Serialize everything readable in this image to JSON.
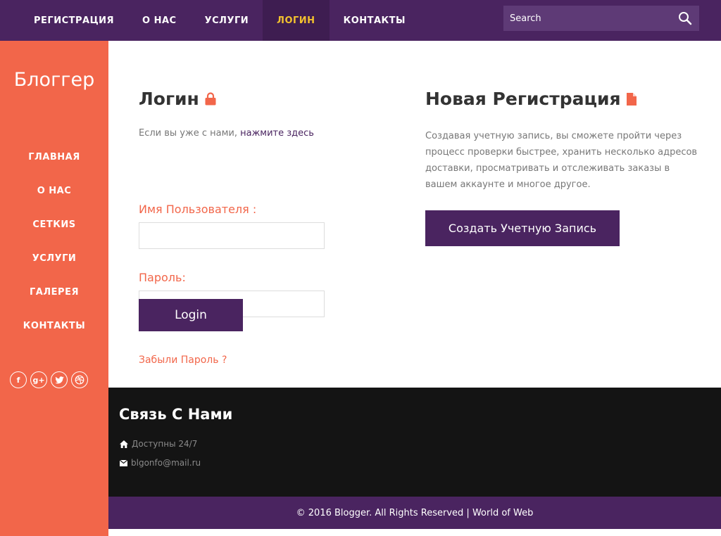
{
  "colors": {
    "nav_bg": "#4a2460",
    "nav_active_bg": "#3e1d51",
    "nav_active_text": "#f2c12e",
    "sidebar_bg": "#f2664a",
    "accent": "#f2664a",
    "button_bg": "#4a2460",
    "footer_bg": "#141414"
  },
  "topnav": {
    "items": [
      {
        "label": "РЕГИСТРАЦИЯ"
      },
      {
        "label": "О НАС"
      },
      {
        "label": "УСЛУГИ"
      },
      {
        "label": "ЛОГИН",
        "active": true
      },
      {
        "label": "КОНТАКТЫ"
      }
    ],
    "search": {
      "placeholder": "Search",
      "icon": "search-icon"
    }
  },
  "sidebar": {
    "brand": "Блоггер",
    "items": [
      {
        "label": "ГЛАВНАЯ"
      },
      {
        "label": "О НАС"
      },
      {
        "label": "СЕТКИS"
      },
      {
        "label": "УСЛУГИ"
      },
      {
        "label": "ГАЛЕРЕЯ"
      },
      {
        "label": "КОНТАКТЫ"
      }
    ],
    "socials": [
      "facebook-icon",
      "google-plus-icon",
      "twitter-icon",
      "dribbble-icon"
    ]
  },
  "login": {
    "title": "Логин",
    "icon": "lock-icon",
    "hint_text": "Если вы уже с нами,",
    "hint_link": "нажмите здесь",
    "username_label": "Имя Пользователя :",
    "username_value": "",
    "password_label": "Пароль:",
    "password_value": "",
    "submit_label": "Login",
    "forgot_label": "Забыли Пароль ?"
  },
  "register": {
    "title": "Новая Регистрация",
    "icon": "document-icon",
    "text": "Создавая учетную запись, вы сможете пройти через процесс проверки быстрее, хранить несколько адресов доставки, просматривать и отслеживать заказы в вашем аккаунте и многое другое.",
    "button_label": "Создать Учетную Запись"
  },
  "footer": {
    "title": "Связь С Нами",
    "availability": "Доступны 24/7",
    "email": "blgonfo@mail.ru",
    "copyright": "© 2016 Blogger. All Rights Reserved |",
    "credit_link": "World of Web"
  }
}
